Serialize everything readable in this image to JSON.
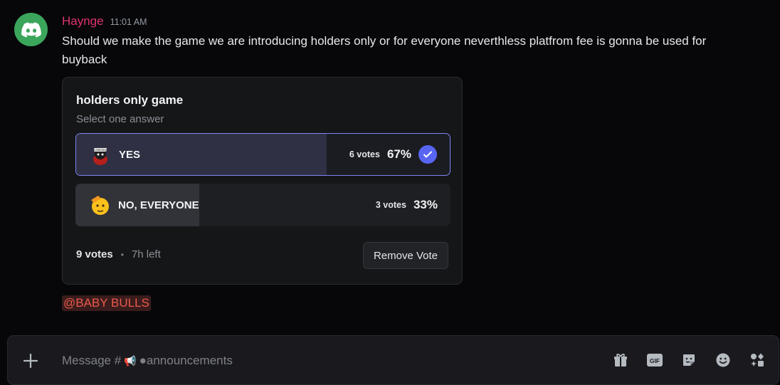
{
  "message": {
    "author": "Haynge",
    "timestamp": "11:01 AM",
    "text": "Should we make the game we are introducing holders only or for everyone neverthless platfrom fee is gonna be used for buyback",
    "mention": "@BABY BULLS"
  },
  "poll": {
    "question": "holders only game",
    "hint": "Select one answer",
    "answers": [
      {
        "label": "YES",
        "votes": "6 votes",
        "percent": "67%",
        "fraction": 0.67,
        "selected": true,
        "emoji": "listening-pepe-emoji"
      },
      {
        "label": "NO, EVERYONE",
        "votes": "3 votes",
        "percent": "33%",
        "fraction": 0.33,
        "selected": false,
        "emoji": "saluting-face-emoji"
      }
    ],
    "total_votes": "9 votes",
    "separator": "•",
    "time_left": "7h left",
    "remove_vote_label": "Remove Vote"
  },
  "composer": {
    "placeholder_prefix": "Message #",
    "channel": "●announcements",
    "tools": [
      "gift-icon",
      "gif-icon",
      "sticker-icon",
      "emoji-icon",
      "apps-icon"
    ]
  },
  "colors": {
    "author": "#e0336d",
    "avatar_bg": "#3ba55c",
    "accent": "#5865f2",
    "mention": "#ea5a4b"
  }
}
